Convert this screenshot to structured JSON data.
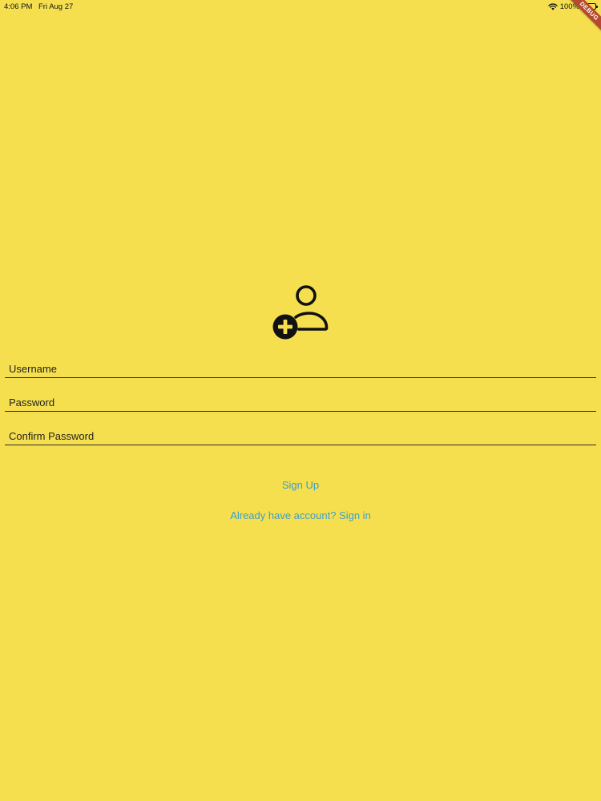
{
  "status_bar": {
    "time": "4:06 PM",
    "date": "Fri Aug 27",
    "battery": "100%",
    "wifi_icon": "wifi-icon",
    "battery_icon": "battery-icon"
  },
  "debug_banner": {
    "label": "DEBUG"
  },
  "header_icon": "person-add-icon",
  "form": {
    "username_placeholder": "Username",
    "password_placeholder": "Password",
    "confirm_password_placeholder": "Confirm Password",
    "signup_label": "Sign Up",
    "signin_link_label": "Already have account? Sign in"
  },
  "colors": {
    "background": "#F6DF4F",
    "link": "#3D9FC9",
    "text": "#111111",
    "debug_banner": "#B54A2E"
  }
}
